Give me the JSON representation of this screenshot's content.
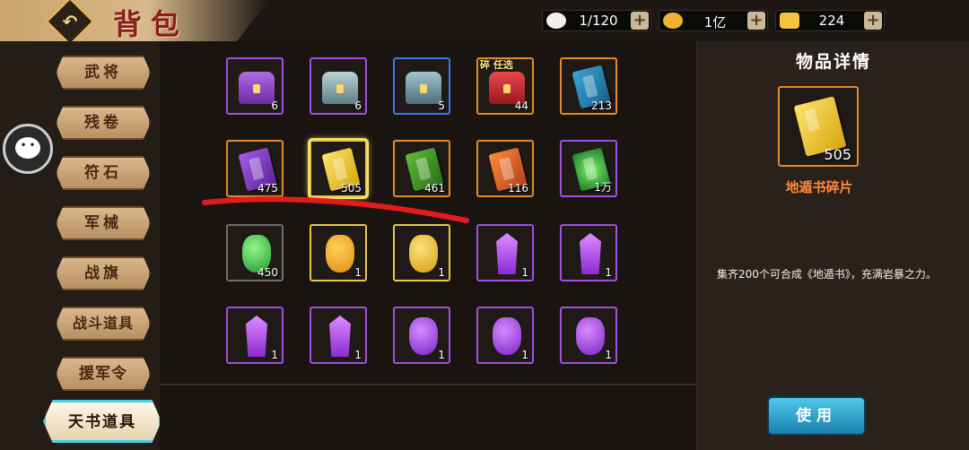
{
  "header": {
    "title": "背包",
    "resources": [
      {
        "name": "stamina",
        "value": "1/120",
        "color": "#f2efe6"
      },
      {
        "name": "coins",
        "value": "1亿",
        "color": "#f2b233"
      },
      {
        "name": "ingots",
        "value": "224",
        "color": "#f5c542"
      }
    ]
  },
  "sidebar": {
    "items": [
      {
        "label": "武将"
      },
      {
        "label": "残卷"
      },
      {
        "label": "符石"
      },
      {
        "label": "军械"
      },
      {
        "label": "战旗"
      },
      {
        "label": "战斗道具"
      },
      {
        "label": "援军令"
      },
      {
        "label": "天书道具",
        "active": true
      }
    ]
  },
  "grid": {
    "items": [
      {
        "icon": "chest-purple-icon",
        "count": "6",
        "border": "purple"
      },
      {
        "icon": "chest-silver-icon",
        "count": "6",
        "border": "purple"
      },
      {
        "icon": "chest-ice-icon",
        "count": "5",
        "border": "blue"
      },
      {
        "icon": "chest-red-icon",
        "count": "44",
        "border": "orange",
        "tag": "碎 任选"
      },
      {
        "icon": "book-blue-icon",
        "count": "213",
        "border": "orange"
      },
      {
        "icon": "book-purple-icon",
        "count": "475",
        "border": "orange"
      },
      {
        "icon": "book-gold-icon",
        "count": "505",
        "border": "gold",
        "selected": true
      },
      {
        "icon": "book-green-icon",
        "count": "461",
        "border": "orange"
      },
      {
        "icon": "book-orange-icon",
        "count": "116",
        "border": "orange"
      },
      {
        "icon": "book-glow-icon",
        "count": "1万",
        "border": "purple"
      },
      {
        "icon": "gem-green-icon",
        "count": "450",
        "border": "green"
      },
      {
        "icon": "gem-orange-icon",
        "count": "1",
        "border": "gold"
      },
      {
        "icon": "gem-gold-icon",
        "count": "1",
        "border": "gold"
      },
      {
        "icon": "crystal-violet-icon",
        "count": "1",
        "border": "purple"
      },
      {
        "icon": "crystal-violet-icon",
        "count": "1",
        "border": "purple"
      },
      {
        "icon": "crystal-violet-icon",
        "count": "1",
        "border": "purple"
      },
      {
        "icon": "crystal-violet-icon",
        "count": "1",
        "border": "purple"
      },
      {
        "icon": "rune-violet-icon",
        "count": "1",
        "border": "purple"
      },
      {
        "icon": "rune-violet-icon",
        "count": "1",
        "border": "purple"
      },
      {
        "icon": "rune-violet-icon",
        "count": "1",
        "border": "purple"
      }
    ]
  },
  "detail": {
    "title": "物品详情",
    "count": "505",
    "name": "地遁书碎片",
    "description": "集齐200个可合成《地遁书》，充满岩暴之力。",
    "use_label": "使用"
  },
  "colors": {
    "accent_cyan": "#46d0e8",
    "detail_name": "#ff8a3a",
    "annotation_red": "#e21c1c"
  }
}
